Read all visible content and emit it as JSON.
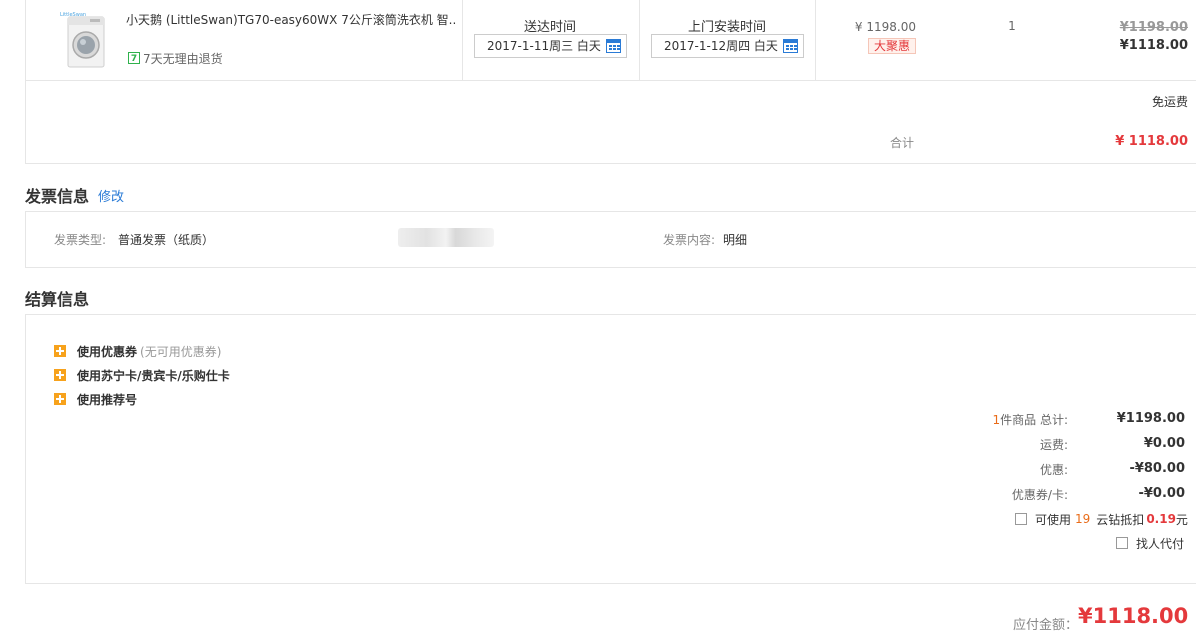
{
  "product": {
    "name": "小天鹅 (LittleSwan)TG70-easy60WX 7公斤滚筒洗衣机 智...",
    "return_policy": "7天无理由退货",
    "return_icon_text": "7",
    "delivery_time_label": "送达时间",
    "delivery_date": "2017-1-11周三 白天",
    "install_time_label": "上门安装时间",
    "install_date": "2017-1-12周四 白天",
    "unit_price": "¥ 1198.00",
    "promo_tag": "大聚惠",
    "quantity": "1",
    "original_total": "¥1198.00",
    "subtotal": "¥1118.00"
  },
  "shipping": {
    "free_shipping": "免运费",
    "total_label": "合计",
    "total_value": "¥ 1118.00"
  },
  "invoice": {
    "title": "发票信息",
    "edit_link": "修改",
    "type_label": "发票类型:",
    "type_value": "普通发票（纸质）",
    "content_label": "发票内容:",
    "content_value": "明细"
  },
  "settlement": {
    "title": "结算信息",
    "options": [
      {
        "label": "使用优惠券",
        "note": "(无可用优惠券)"
      },
      {
        "label": "使用苏宁卡/贵宾卡/乐购仕卡",
        "note": ""
      },
      {
        "label": "使用推荐号",
        "note": ""
      }
    ],
    "item_count": "1",
    "item_count_suffix": "件商品  总计:",
    "goods_total": "¥1198.00",
    "freight_label": "运费:",
    "freight_value": "¥0.00",
    "discount_label": "优惠:",
    "discount_value": "-¥80.00",
    "coupon_label": "优惠券/卡:",
    "coupon_value": "-¥0.00",
    "diamond_prefix": "可使用",
    "diamond_count": "19",
    "diamond_mid": "云钻抵扣",
    "diamond_amount": "0.19",
    "diamond_unit": "元",
    "proxy_pay": "找人代付"
  },
  "payable": {
    "label": "应付金额：",
    "amount": "¥1118.00"
  },
  "colors": {
    "accent_red": "#e4393c",
    "link_blue": "#2a7bd6",
    "plus_orange": "#f7a21c"
  }
}
